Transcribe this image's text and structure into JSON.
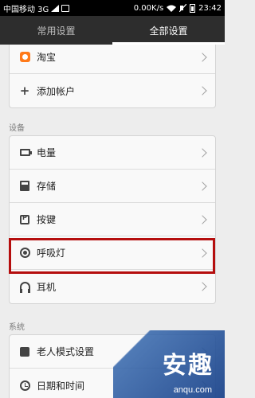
{
  "status_bar": {
    "carrier": "中国移动 3G",
    "speed": "0.00K/s",
    "time": "23:42"
  },
  "tabs": [
    {
      "label": "常用设置",
      "active": false
    },
    {
      "label": "全部设置",
      "active": true
    }
  ],
  "accounts": {
    "items": [
      {
        "label": "淘宝",
        "icon": "taobao-icon"
      },
      {
        "label": "添加帐户",
        "icon": "plus-icon"
      }
    ]
  },
  "device_section": {
    "title": "设备",
    "items": [
      {
        "label": "电量",
        "icon": "battery-icon"
      },
      {
        "label": "存储",
        "icon": "storage-icon"
      },
      {
        "label": "按键",
        "icon": "key-icon"
      },
      {
        "label": "呼吸灯",
        "icon": "breathing-light-icon",
        "highlighted": true
      },
      {
        "label": "耳机",
        "icon": "headset-icon"
      }
    ]
  },
  "system_section": {
    "title": "系统",
    "items": [
      {
        "label": "老人模式设置",
        "icon": "elder-mode-icon"
      },
      {
        "label": "日期和时间",
        "icon": "clock-icon"
      }
    ]
  },
  "watermark": {
    "big": "安趣",
    "small": "anqu.com"
  },
  "colors": {
    "highlight_border": "#b50e0e",
    "tabbar_bg": "#2d2d2d",
    "page_bg": "#ededed"
  }
}
